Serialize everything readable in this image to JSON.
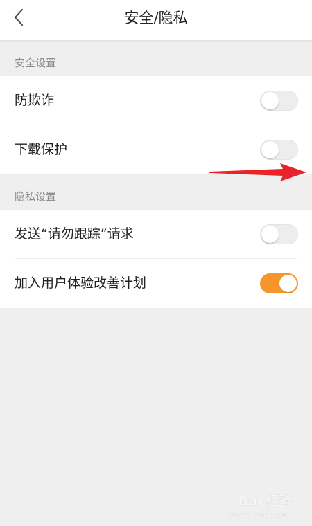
{
  "header": {
    "title": "安全/隐私",
    "back_icon": "chevron-left-icon"
  },
  "security_section": {
    "label": "安全设置",
    "items": [
      {
        "label": "防欺诈",
        "enabled": false
      },
      {
        "label": "下载保护",
        "enabled": false
      }
    ]
  },
  "privacy_section": {
    "label": "隐私设置",
    "items": [
      {
        "label": "发送“请勿跟踪”请求",
        "enabled": false
      },
      {
        "label": "加入用户体验改善计划",
        "enabled": true
      }
    ]
  },
  "annotation": {
    "arrow_color": "#e8242a"
  },
  "watermark": {
    "text": "Bai 经验",
    "sub": "jingyan.baidu.com"
  },
  "colors": {
    "toggle_on": "#f7952a",
    "toggle_off": "#ededed",
    "background": "#efefef"
  }
}
